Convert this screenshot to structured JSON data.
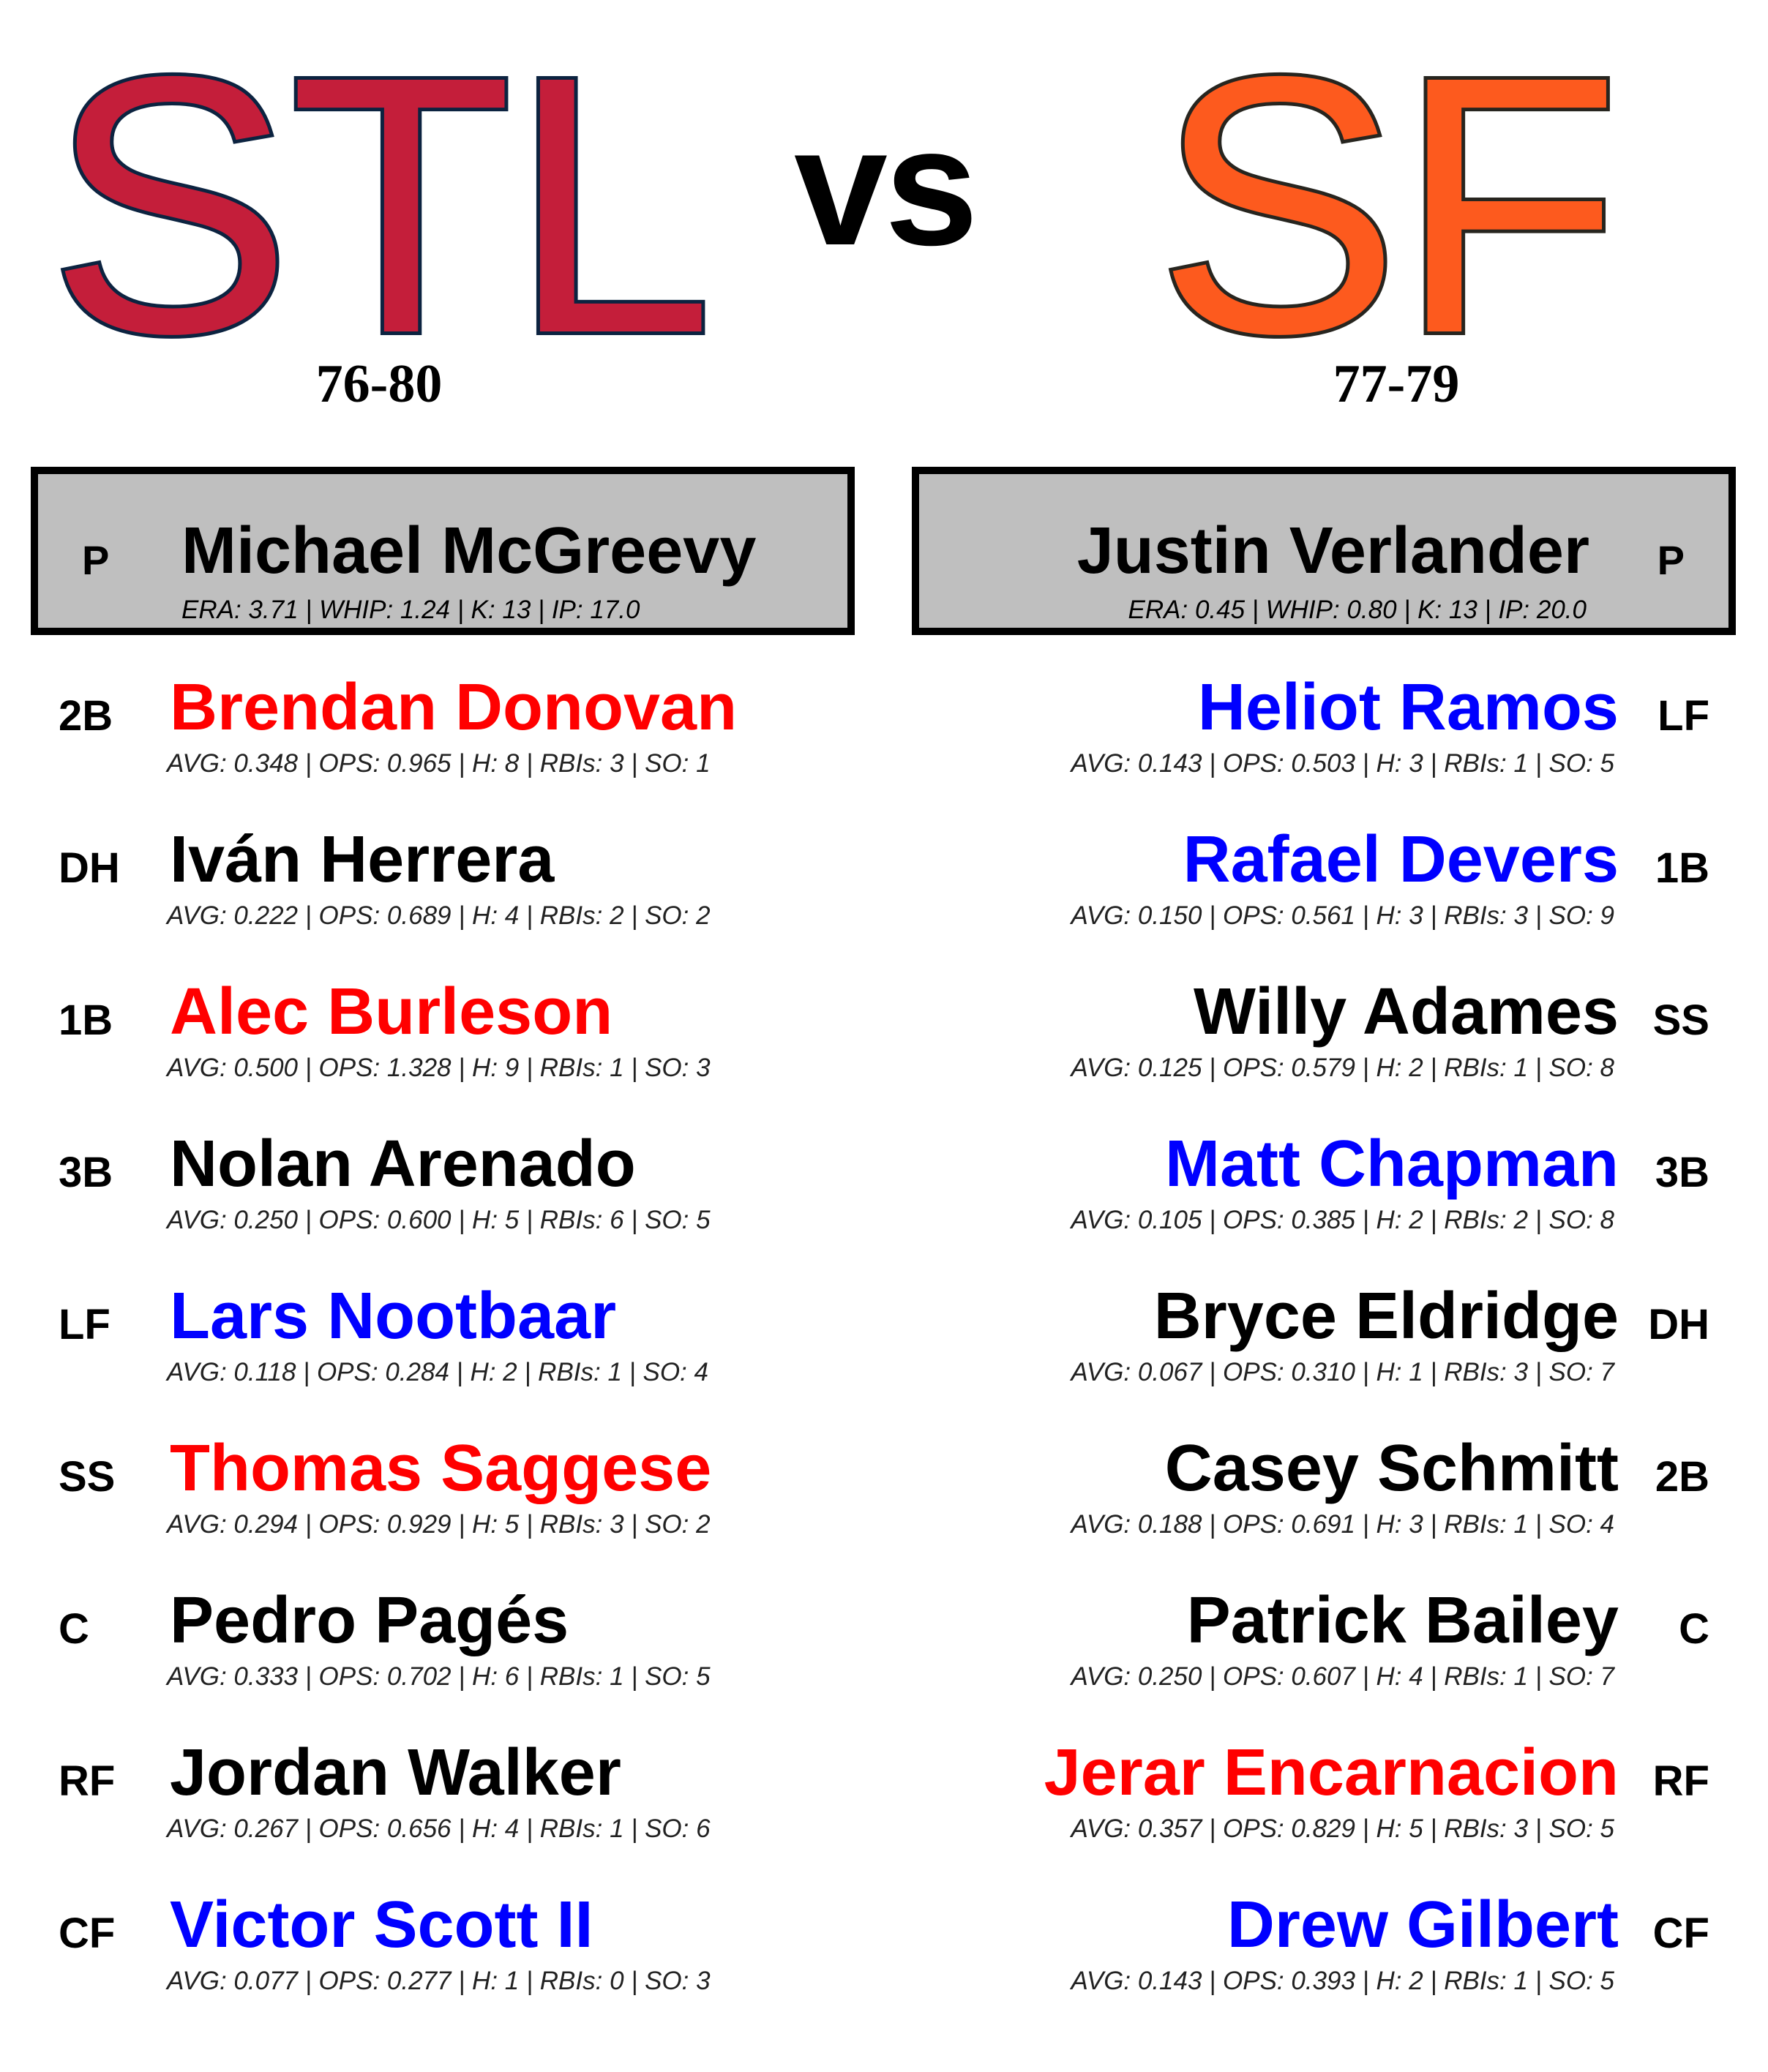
{
  "away": {
    "abbr": "STL",
    "record": "76-80",
    "fill_color": "#c41e3a",
    "stroke_color": "#0c2340",
    "pitcher": {
      "pos": "P",
      "name": "Michael McGreevy",
      "stats": "ERA: 3.71 | WHIP: 1.24 | K: 13 | IP: 17.0"
    },
    "lineup": [
      {
        "pos": "2B",
        "name": "Brendan Donovan",
        "color": "#ff0000",
        "stats": "AVG: 0.348 | OPS: 0.965 | H: 8 | RBIs: 3 | SO: 1"
      },
      {
        "pos": "DH",
        "name": "Iván Herrera",
        "color": "#000000",
        "stats": "AVG: 0.222 | OPS: 0.689 | H: 4 | RBIs: 2 | SO: 2"
      },
      {
        "pos": "1B",
        "name": "Alec Burleson",
        "color": "#ff0000",
        "stats": "AVG: 0.500 | OPS: 1.328 | H: 9 | RBIs: 1 | SO: 3"
      },
      {
        "pos": "3B",
        "name": "Nolan Arenado",
        "color": "#000000",
        "stats": "AVG: 0.250 | OPS: 0.600 | H: 5 | RBIs: 6 | SO: 5"
      },
      {
        "pos": "LF",
        "name": "Lars Nootbaar",
        "color": "#0000ff",
        "stats": "AVG: 0.118 | OPS: 0.284 | H: 2 | RBIs: 1 | SO: 4"
      },
      {
        "pos": "SS",
        "name": "Thomas Saggese",
        "color": "#ff0000",
        "stats": "AVG: 0.294 | OPS: 0.929 | H: 5 | RBIs: 3 | SO: 2"
      },
      {
        "pos": "C",
        "name": "Pedro Pagés",
        "color": "#000000",
        "stats": "AVG: 0.333 | OPS: 0.702 | H: 6 | RBIs: 1 | SO: 5"
      },
      {
        "pos": "RF",
        "name": "Jordan Walker",
        "color": "#000000",
        "stats": "AVG: 0.267 | OPS: 0.656 | H: 4 | RBIs: 1 | SO: 6"
      },
      {
        "pos": "CF",
        "name": "Victor Scott II",
        "color": "#0000ff",
        "stats": "AVG: 0.077 | OPS: 0.277 | H: 1 | RBIs: 0 | SO: 3"
      }
    ]
  },
  "vs_text": "vs",
  "home": {
    "abbr": "SF",
    "record": "77-79",
    "fill_color": "#fd5a1e",
    "stroke_color": "#27251f",
    "pitcher": {
      "pos": "P",
      "name": "Justin Verlander",
      "stats": "ERA: 0.45 | WHIP: 0.80 | K: 13 | IP: 20.0"
    },
    "lineup": [
      {
        "pos": "LF",
        "name": "Heliot Ramos",
        "color": "#0000ff",
        "stats": "AVG: 0.143 | OPS: 0.503 | H: 3 | RBIs: 1 | SO: 5"
      },
      {
        "pos": "1B",
        "name": "Rafael Devers",
        "color": "#0000ff",
        "stats": "AVG: 0.150 | OPS: 0.561 | H: 3 | RBIs: 3 | SO: 9"
      },
      {
        "pos": "SS",
        "name": "Willy Adames",
        "color": "#000000",
        "stats": "AVG: 0.125 | OPS: 0.579 | H: 2 | RBIs: 1 | SO: 8"
      },
      {
        "pos": "3B",
        "name": "Matt Chapman",
        "color": "#0000ff",
        "stats": "AVG: 0.105 | OPS: 0.385 | H: 2 | RBIs: 2 | SO: 8"
      },
      {
        "pos": "DH",
        "name": "Bryce Eldridge",
        "color": "#000000",
        "stats": "AVG: 0.067 | OPS: 0.310 | H: 1 | RBIs: 3 | SO: 7"
      },
      {
        "pos": "2B",
        "name": "Casey Schmitt",
        "color": "#000000",
        "stats": "AVG: 0.188 | OPS: 0.691 | H: 3 | RBIs: 1 | SO: 4"
      },
      {
        "pos": "C",
        "name": "Patrick Bailey",
        "color": "#000000",
        "stats": "AVG: 0.250 | OPS: 0.607 | H: 4 | RBIs: 1 | SO: 7"
      },
      {
        "pos": "RF",
        "name": "Jerar Encarnacion",
        "color": "#ff0000",
        "stats": "AVG: 0.357 | OPS: 0.829 | H: 5 | RBIs: 3 | SO: 5"
      },
      {
        "pos": "CF",
        "name": "Drew Gilbert",
        "color": "#0000ff",
        "stats": "AVG: 0.143 | OPS: 0.393 | H: 2 | RBIs: 1 | SO: 5"
      }
    ]
  }
}
